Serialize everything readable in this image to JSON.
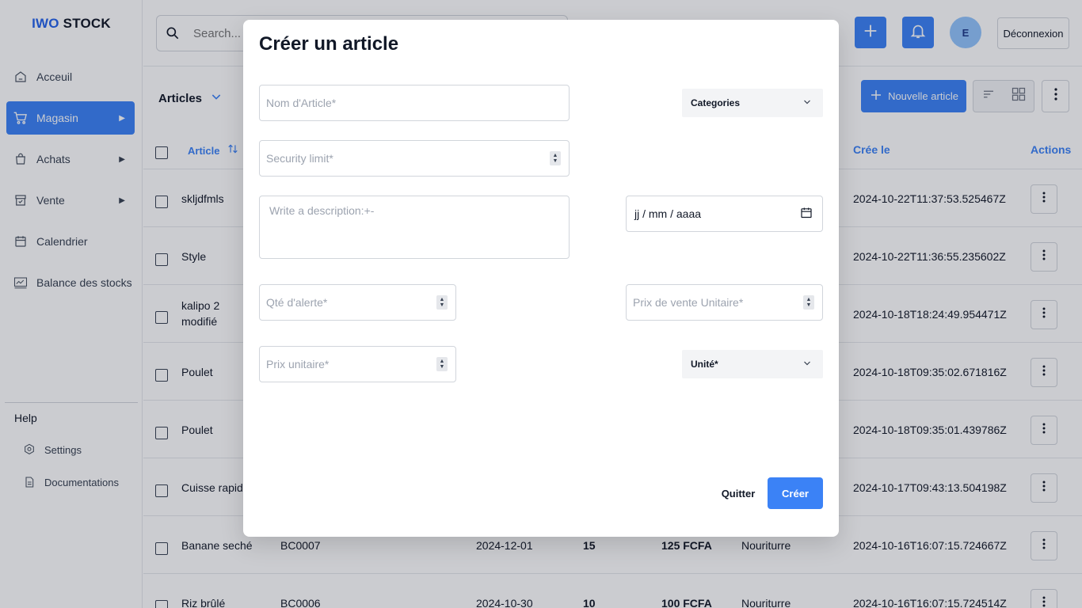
{
  "app": {
    "logo_part1": "IWO",
    "logo_part2": "STOCK"
  },
  "sidebar": {
    "items": [
      {
        "label": "Acceuil",
        "icon": "home-icon",
        "has_arrow": false
      },
      {
        "label": "Magasin",
        "icon": "cart-icon",
        "has_arrow": true,
        "active": true
      },
      {
        "label": "Achats",
        "icon": "bag-icon",
        "has_arrow": true
      },
      {
        "label": "Vente",
        "icon": "archive-icon",
        "has_arrow": true
      },
      {
        "label": "Calendrier",
        "icon": "calendar-icon",
        "has_arrow": false
      },
      {
        "label": "Balance des stocks",
        "icon": "chart-icon",
        "has_arrow": false
      }
    ],
    "help_title": "Help",
    "help_items": [
      {
        "label": "Settings",
        "icon": "settings-icon"
      },
      {
        "label": "Documentations",
        "icon": "document-icon"
      }
    ]
  },
  "header": {
    "search_placeholder": "Search...",
    "avatar_initial": "E",
    "logout_label": "Déconnexion"
  },
  "toolbar": {
    "title": "Articles",
    "new_button_label": "Nouvelle article"
  },
  "table": {
    "headers": {
      "article": "Article",
      "created": "Crée le",
      "actions": "Actions"
    },
    "rows": [
      {
        "name": "skljdfmls",
        "name2": "",
        "code": "",
        "date": "",
        "qty": "",
        "price": "",
        "category": "",
        "created": "2024-10-22T11:37:53.525467Z"
      },
      {
        "name": "Style",
        "name2": "",
        "code": "",
        "date": "",
        "qty": "",
        "price": "",
        "category": "",
        "created": "2024-10-22T11:36:55.235602Z"
      },
      {
        "name": "kalipo 2",
        "name2": "modifié",
        "code": "",
        "date": "",
        "qty": "",
        "price": "",
        "category": "",
        "created": "2024-10-18T18:24:49.954471Z"
      },
      {
        "name": "Poulet",
        "name2": "",
        "code": "",
        "date": "",
        "qty": "",
        "price": "",
        "category": "",
        "created": "2024-10-18T09:35:02.671816Z"
      },
      {
        "name": "Poulet",
        "name2": "",
        "code": "",
        "date": "",
        "qty": "",
        "price": "",
        "category": "",
        "created": "2024-10-18T09:35:01.439786Z"
      },
      {
        "name": "Cuisse rapide",
        "name2": "",
        "code": "",
        "date": "",
        "qty": "",
        "price": "",
        "category": "",
        "created": "2024-10-17T09:43:13.504198Z"
      },
      {
        "name": "Banane seché",
        "name2": "",
        "code": "BC0007",
        "date": "2024-12-01",
        "qty": "15",
        "price": "125 FCFA",
        "category": "Nouriturre",
        "created": "2024-10-16T16:07:15.724667Z"
      },
      {
        "name": "Riz brûlé",
        "name2": "",
        "code": "BC0006",
        "date": "2024-10-30",
        "qty": "10",
        "price": "100 FCFA",
        "category": "Nouriturre",
        "created": "2024-10-16T16:07:15.724514Z"
      }
    ]
  },
  "modal": {
    "title": "Créer un article",
    "name_placeholder": "Nom d'Article*",
    "categories_label": "Categories",
    "security_placeholder": "Security limit*",
    "description_placeholder": "Write a description:+-",
    "date_placeholder": "jj / mm / aaaa",
    "alert_qty_placeholder": "Qté d'alerte*",
    "sale_price_placeholder": "Prix de vente Unitaire*",
    "unit_price_placeholder": "Prix unitaire*",
    "unit_label": "Unité*",
    "quit_label": "Quitter",
    "create_label": "Créer"
  },
  "colors": {
    "accent": "#3b82f6",
    "overlay": "rgba(17,24,39,0.22)"
  }
}
